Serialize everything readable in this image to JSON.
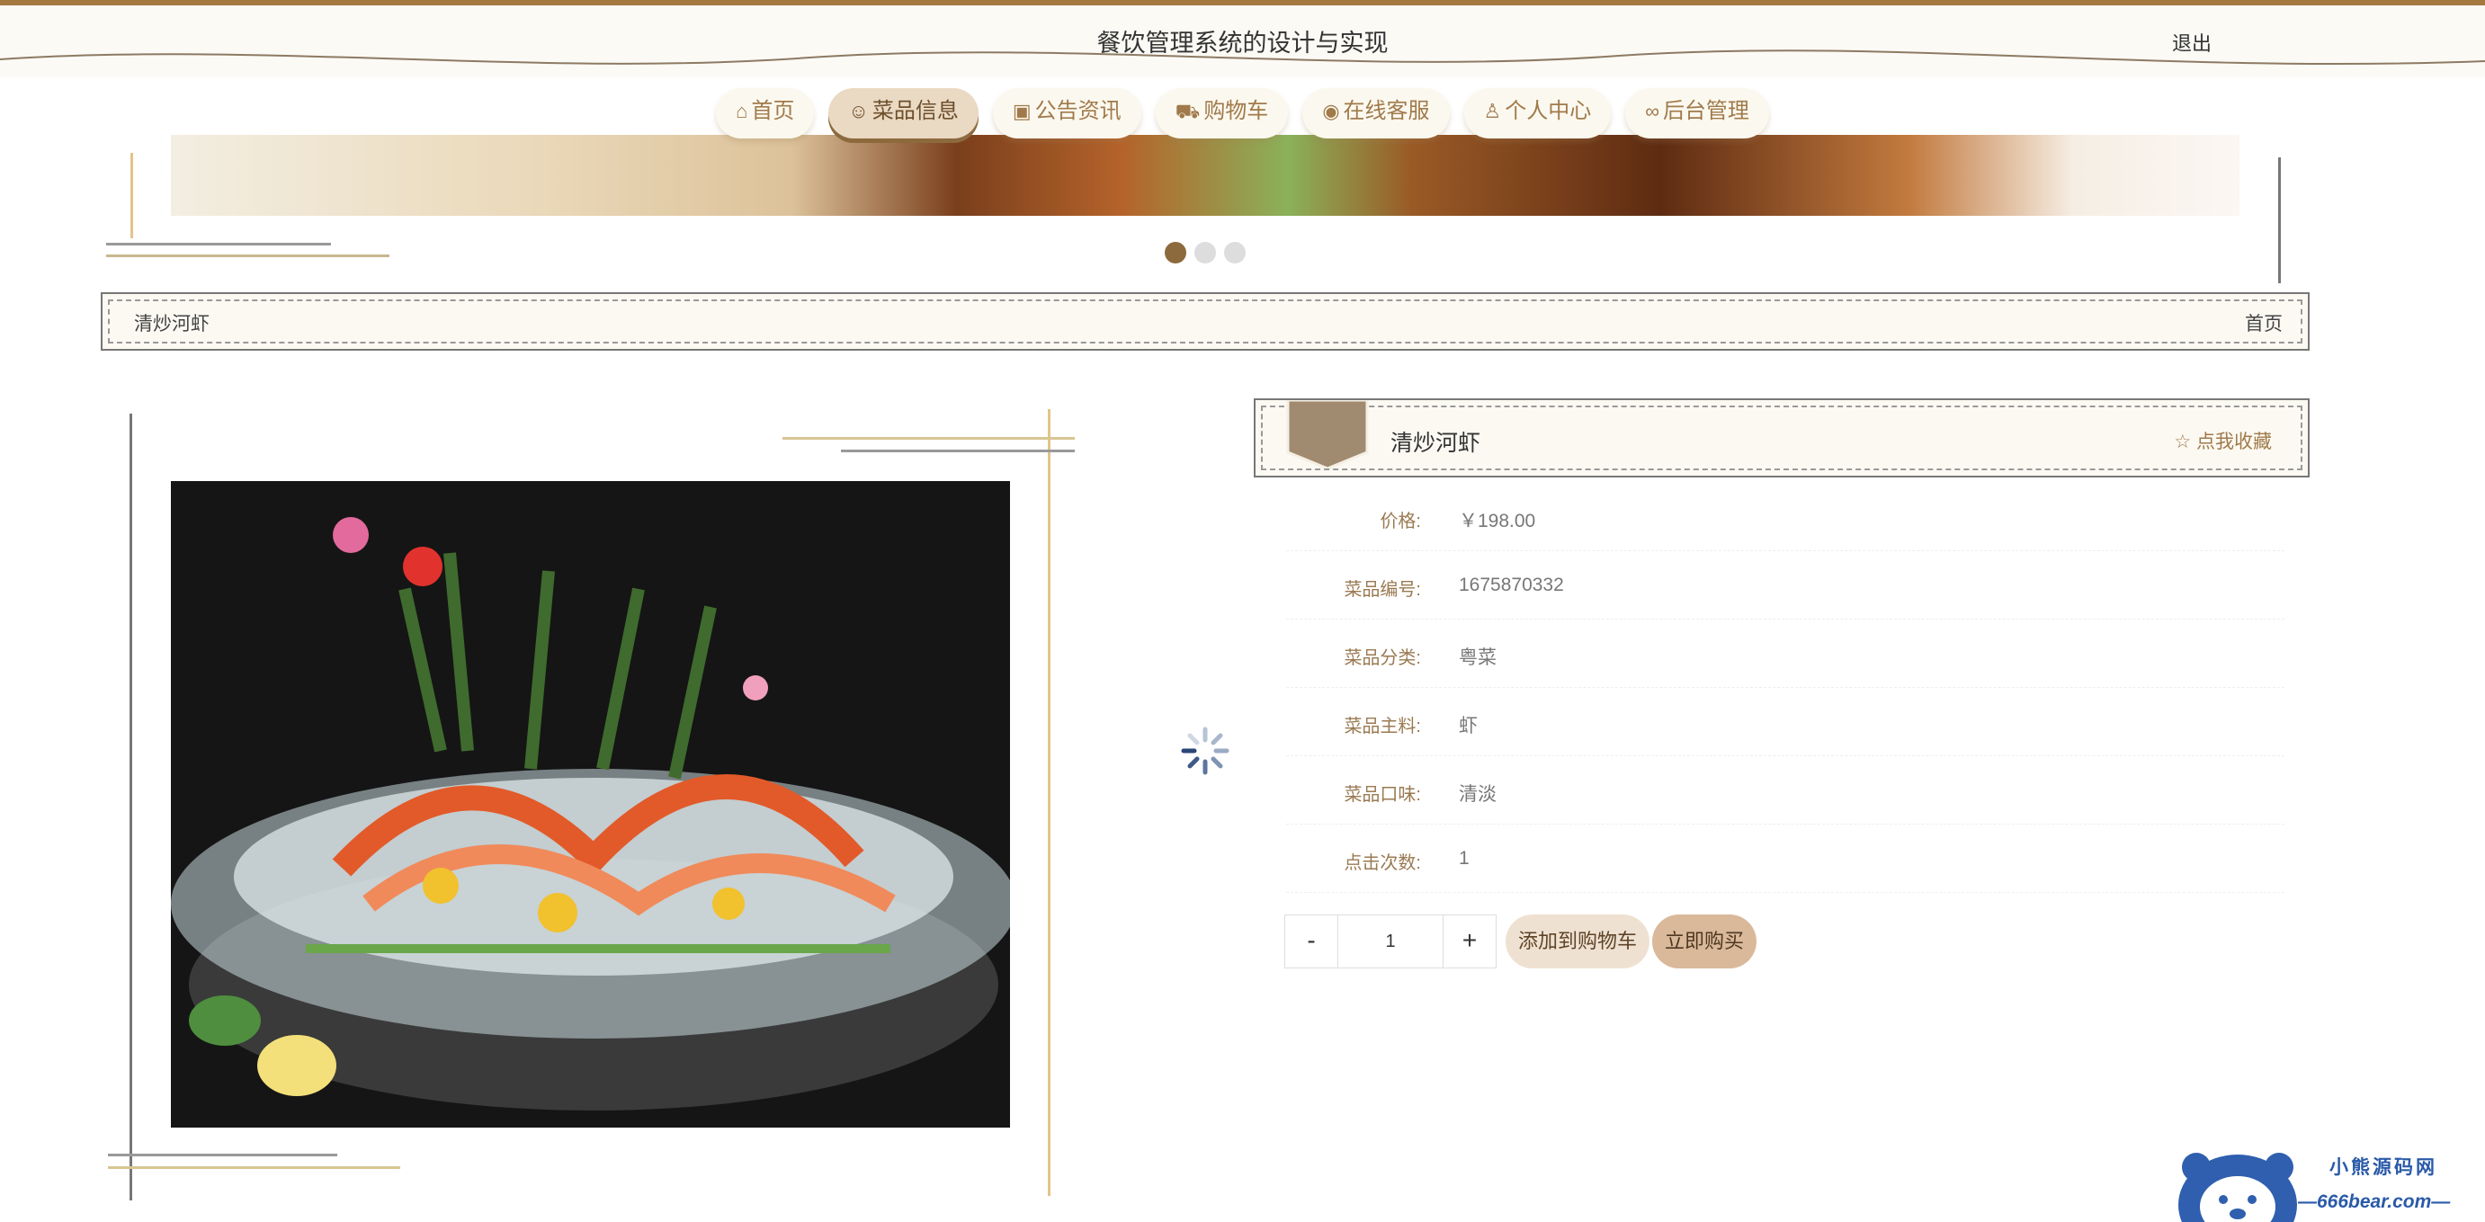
{
  "header": {
    "title": "餐饮管理系统的设计与实现",
    "logout": "退出"
  },
  "nav": [
    {
      "label": "首页",
      "icon": "home-icon",
      "active": false
    },
    {
      "label": "菜品信息",
      "icon": "smile-icon",
      "active": true
    },
    {
      "label": "公告资讯",
      "icon": "gift-icon",
      "active": false
    },
    {
      "label": "购物车",
      "icon": "cart-icon",
      "active": false
    },
    {
      "label": "在线客服",
      "icon": "chat-icon",
      "active": false
    },
    {
      "label": "个人中心",
      "icon": "user-icon",
      "active": false
    },
    {
      "label": "后台管理",
      "icon": "link-icon",
      "active": false
    }
  ],
  "carousel": {
    "slides": 3,
    "active_index": 0
  },
  "breadcrumb": {
    "current": "清炒河虾",
    "home": "首页"
  },
  "dish": {
    "name": "清炒河虾",
    "favorite_label": "点我收藏",
    "fields": [
      {
        "label": "价格:",
        "value": "￥198.00"
      },
      {
        "label": "菜品编号:",
        "value": "1675870332"
      },
      {
        "label": "菜品分类:",
        "value": "粤菜"
      },
      {
        "label": "菜品主料:",
        "value": "虾"
      },
      {
        "label": "菜品口味:",
        "value": "清淡"
      },
      {
        "label": "点击次数:",
        "value": "1"
      }
    ]
  },
  "quantity": {
    "minus": "-",
    "value": "1",
    "plus": "+"
  },
  "actions": {
    "add_to_cart": "添加到购物车",
    "buy_now": "立即购买"
  },
  "watermark": {
    "line1": "小熊源码网",
    "line2": "—666bear.com—"
  },
  "colors": {
    "accent": "#a3793e",
    "active_nav": "#ead9c3",
    "label": "#9a7a52"
  }
}
